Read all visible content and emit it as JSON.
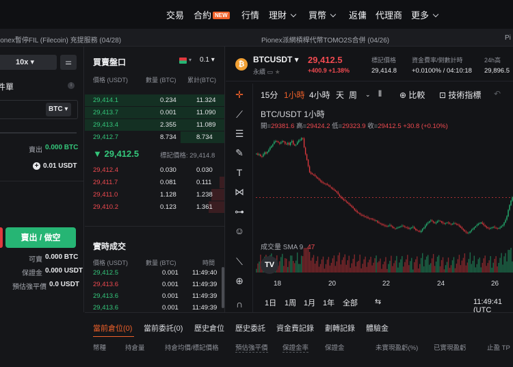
{
  "nav": {
    "items": [
      "交易",
      "合約",
      "行情",
      "理財",
      "買幣",
      "返傭",
      "代理商",
      "更多"
    ],
    "new_badge": "NEW"
  },
  "ticker": {
    "left": "ionex暫停FIL (Filecoin) 充提服務 (04/28)",
    "center": "Pionex派網槓桿代幣TOMO2S合併 (04/26)",
    "right": "Pi"
  },
  "order_panel": {
    "leverage": "10x",
    "mode_title": "件單",
    "coin": "BTC",
    "sell_label": "賣出",
    "sell_value": "0.000 BTC",
    "usdt_value": "0.01 USDT",
    "sell_button": "賣出 / 做空",
    "available_label": "可賣",
    "available_value": "0.000 BTC",
    "margin_label": "保證金",
    "margin_value": "0.000 USDT",
    "liq_label": "預估強平價",
    "liq_value": "0.0 USDT"
  },
  "order_book": {
    "title": "買賣盤口",
    "precision": "0.1",
    "headers": [
      "價格 (USDT)",
      "數量 (BTC)",
      "累計(BTC)"
    ],
    "bids": [
      {
        "price": "29,414.1",
        "qty": "0.234",
        "total": "11.324"
      },
      {
        "price": "29,413.7",
        "qty": "0.001",
        "total": "11.090"
      },
      {
        "price": "29,413.4",
        "qty": "2.355",
        "total": "11.089"
      },
      {
        "price": "29,412.7",
        "qty": "8.734",
        "total": "8.734"
      }
    ],
    "mid_price": "29,412.5",
    "mark_price": "標記價格: 29,414.8",
    "asks": [
      {
        "price": "29,412.4",
        "qty": "0.030",
        "total": "0.030"
      },
      {
        "price": "29,411.7",
        "qty": "0.081",
        "total": "0.111"
      },
      {
        "price": "29,411.0",
        "qty": "1.128",
        "total": "1.238"
      },
      {
        "price": "29,410.2",
        "qty": "0.123",
        "total": "1.361"
      }
    ]
  },
  "trades": {
    "title": "實時成交",
    "headers": [
      "價格 (USDT)",
      "數量 (BTC)",
      "時間"
    ],
    "rows": [
      {
        "price": "29,412.5",
        "qty": "0.001",
        "time": "11:49:40",
        "side": "buy"
      },
      {
        "price": "29,413.6",
        "qty": "0.001",
        "time": "11:49:39",
        "side": "sell"
      },
      {
        "price": "29,413.6",
        "qty": "0.001",
        "time": "11:49:39",
        "side": "buy"
      },
      {
        "price": "29,413.6",
        "qty": "0.001",
        "time": "11:49:39",
        "side": "buy"
      }
    ]
  },
  "header": {
    "symbol": "BTCUSDT",
    "symbol_sub": "永續",
    "price": "29,412.5",
    "change": "+400.9 +1.38%",
    "stats": [
      {
        "label": "標記價格",
        "value": "29,414.8"
      },
      {
        "label": "資金費率/倒數計時",
        "value": "+0.0100% / 04:10:18"
      },
      {
        "label": "24h高",
        "value": "29,896.5"
      }
    ]
  },
  "chart_toolbar": {
    "timeframes": [
      "15分",
      "1小時",
      "4小時",
      "天",
      "周"
    ],
    "active": "1小時",
    "compare": "比較",
    "indicators": "技術指標"
  },
  "chart_data": {
    "type": "candlestick",
    "title": "BTC/USDT   1小時",
    "ohlc_label": {
      "o_key": "開",
      "o": "29381.6",
      "h_key": "高",
      "h": "29424.2",
      "l_key": "低",
      "l": "29323.9",
      "c_key": "收",
      "c": "29412.5",
      "chg": "+30.8 (+0.10%)"
    },
    "volume_label": "成交量  SMA 9",
    "volume_value": "47",
    "x_labels": [
      "18",
      "20",
      "22",
      "24",
      "26"
    ],
    "close_series": [
      28800,
      28780,
      28790,
      28760,
      28750,
      28790,
      28820,
      28800,
      28830,
      28860,
      28900,
      28920,
      28950,
      28990,
      29000,
      28990,
      28980,
      28960,
      28980,
      29000,
      28990,
      28960,
      28950,
      28970,
      28940,
      28980,
      29000,
      28950,
      28930,
      28940,
      28980,
      29010,
      29020,
      29050,
      29040,
      28900,
      28790,
      28700,
      28600,
      28500,
      28480,
      28470,
      28460,
      28440,
      28420,
      28400,
      28380,
      28360,
      28340,
      28330,
      28320,
      28310,
      28300,
      28290,
      28270,
      28250,
      28230,
      28220,
      28200,
      28180,
      28150,
      28120,
      28100,
      28080,
      28060,
      28050,
      28030,
      28010,
      27990,
      27970,
      27950,
      27930,
      27900,
      27880,
      27860,
      27850,
      27830,
      27820,
      27810,
      27800,
      27790,
      27780,
      27770,
      27760,
      27760,
      27750,
      27740,
      27730,
      27730,
      27700,
      27690,
      27680,
      27670,
      27660,
      27650,
      27640,
      27640,
      27650,
      27660,
      27640,
      27620,
      27610,
      27600,
      27610,
      27620,
      27630,
      27640,
      27650,
      27640,
      27630,
      27620,
      27610,
      27600,
      27610,
      27620,
      27630,
      27600,
      27580,
      27570,
      27560,
      27550,
      27570,
      27600,
      27620,
      27650,
      27680,
      27700,
      27720,
      27730,
      27720,
      27700,
      27690,
      27700,
      27720,
      27730,
      27720,
      27700,
      27690,
      27680,
      27690,
      27700,
      27690,
      27680,
      27670,
      27680,
      27690,
      27680,
      27670,
      27660,
      27640,
      27620,
      27600,
      27580,
      27560,
      27540,
      27530,
      27540,
      27560,
      27580,
      27600,
      27620,
      27640,
      27660,
      27680,
      27690,
      27700,
      27680,
      27660,
      27640,
      27620,
      27610,
      27600,
      27610,
      27620,
      27630,
      27620,
      27610,
      27600,
      27610,
      27620,
      27640,
      27660,
      27700,
      27740,
      27800,
      27900,
      27980,
      28050,
      28100
    ]
  },
  "chart_range": {
    "ranges": [
      "1日",
      "1周",
      "1月",
      "1年",
      "全部"
    ],
    "time": "11:49:41 (UTC"
  },
  "bottom_tabs": {
    "tabs": [
      "當前倉位(0)",
      "當前委託(0)",
      "歷史倉位",
      "歷史委託",
      "資金費記錄",
      "劃轉記錄",
      "體驗金"
    ],
    "columns": [
      "幣種",
      "持倉量",
      "持倉均價/標記價格",
      "預估強平價",
      "保證金率",
      "保證金",
      "未實現盈虧(%)",
      "已實現盈虧",
      "止盈 TP"
    ]
  },
  "colors": {
    "up": "#26b574",
    "down": "#e0393e",
    "accent": "#f0612a"
  }
}
